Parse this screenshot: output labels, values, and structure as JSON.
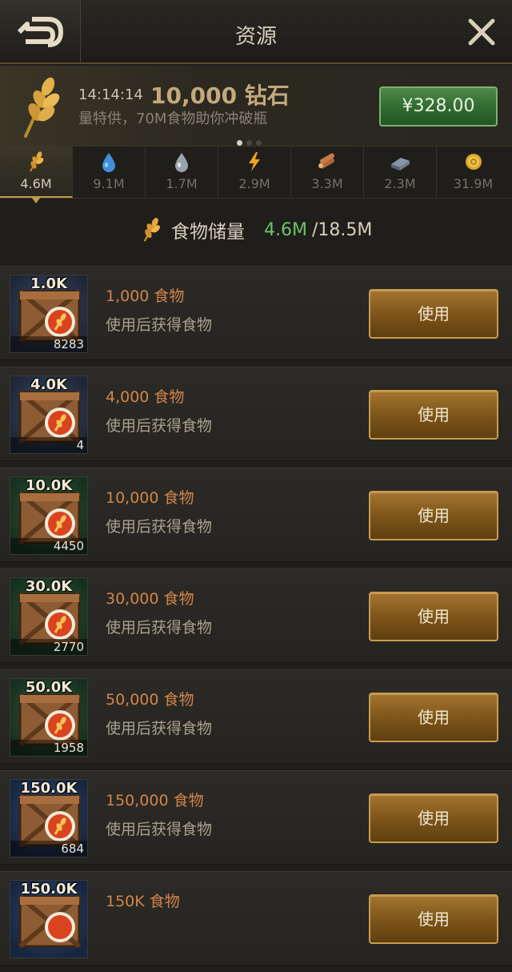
{
  "header": {
    "title": "资源"
  },
  "banner": {
    "timer": "14:14:14",
    "amount": "10,000 钻石",
    "description": "量特供，70M食物助你冲破瓶",
    "price": "¥328.00",
    "page_count": 3,
    "active_page": 1
  },
  "tabs": [
    {
      "icon": "wheat-icon",
      "value": "4.6M",
      "active": true
    },
    {
      "icon": "water-drop-icon",
      "value": "9.1M",
      "active": false
    },
    {
      "icon": "oil-drop-icon",
      "value": "1.7M",
      "active": false
    },
    {
      "icon": "lightning-icon",
      "value": "2.9M",
      "active": false
    },
    {
      "icon": "wood-logs-icon",
      "value": "3.3M",
      "active": false
    },
    {
      "icon": "steel-ingot-icon",
      "value": "2.3M",
      "active": false
    },
    {
      "icon": "gold-coin-icon",
      "value": "31.9M",
      "active": false
    }
  ],
  "storage": {
    "label": "食物储量",
    "current": "4.6M",
    "max": "/18.5M"
  },
  "items": [
    {
      "badge": "1.0K",
      "count": "8283",
      "name": "1,000 食物",
      "desc": "使用后获得食物",
      "button": "使用",
      "bg": "blue"
    },
    {
      "badge": "4.0K",
      "count": "4",
      "name": "4,000 食物",
      "desc": "使用后获得食物",
      "button": "使用",
      "bg": "blue"
    },
    {
      "badge": "10.0K",
      "count": "4450",
      "name": "10,000 食物",
      "desc": "使用后获得食物",
      "button": "使用",
      "bg": "green"
    },
    {
      "badge": "30.0K",
      "count": "2770",
      "name": "30,000 食物",
      "desc": "使用后获得食物",
      "button": "使用",
      "bg": "green"
    },
    {
      "badge": "50.0K",
      "count": "1958",
      "name": "50,000 食物",
      "desc": "使用后获得食物",
      "button": "使用",
      "bg": "green"
    },
    {
      "badge": "150.0K",
      "count": "684",
      "name": "150,000 食物",
      "desc": "使用后获得食物",
      "button": "使用",
      "bg": "navy"
    },
    {
      "badge": "150.0K",
      "count": "",
      "name": "150K 食物",
      "desc": "",
      "button": "使用",
      "bg": "navy"
    }
  ]
}
